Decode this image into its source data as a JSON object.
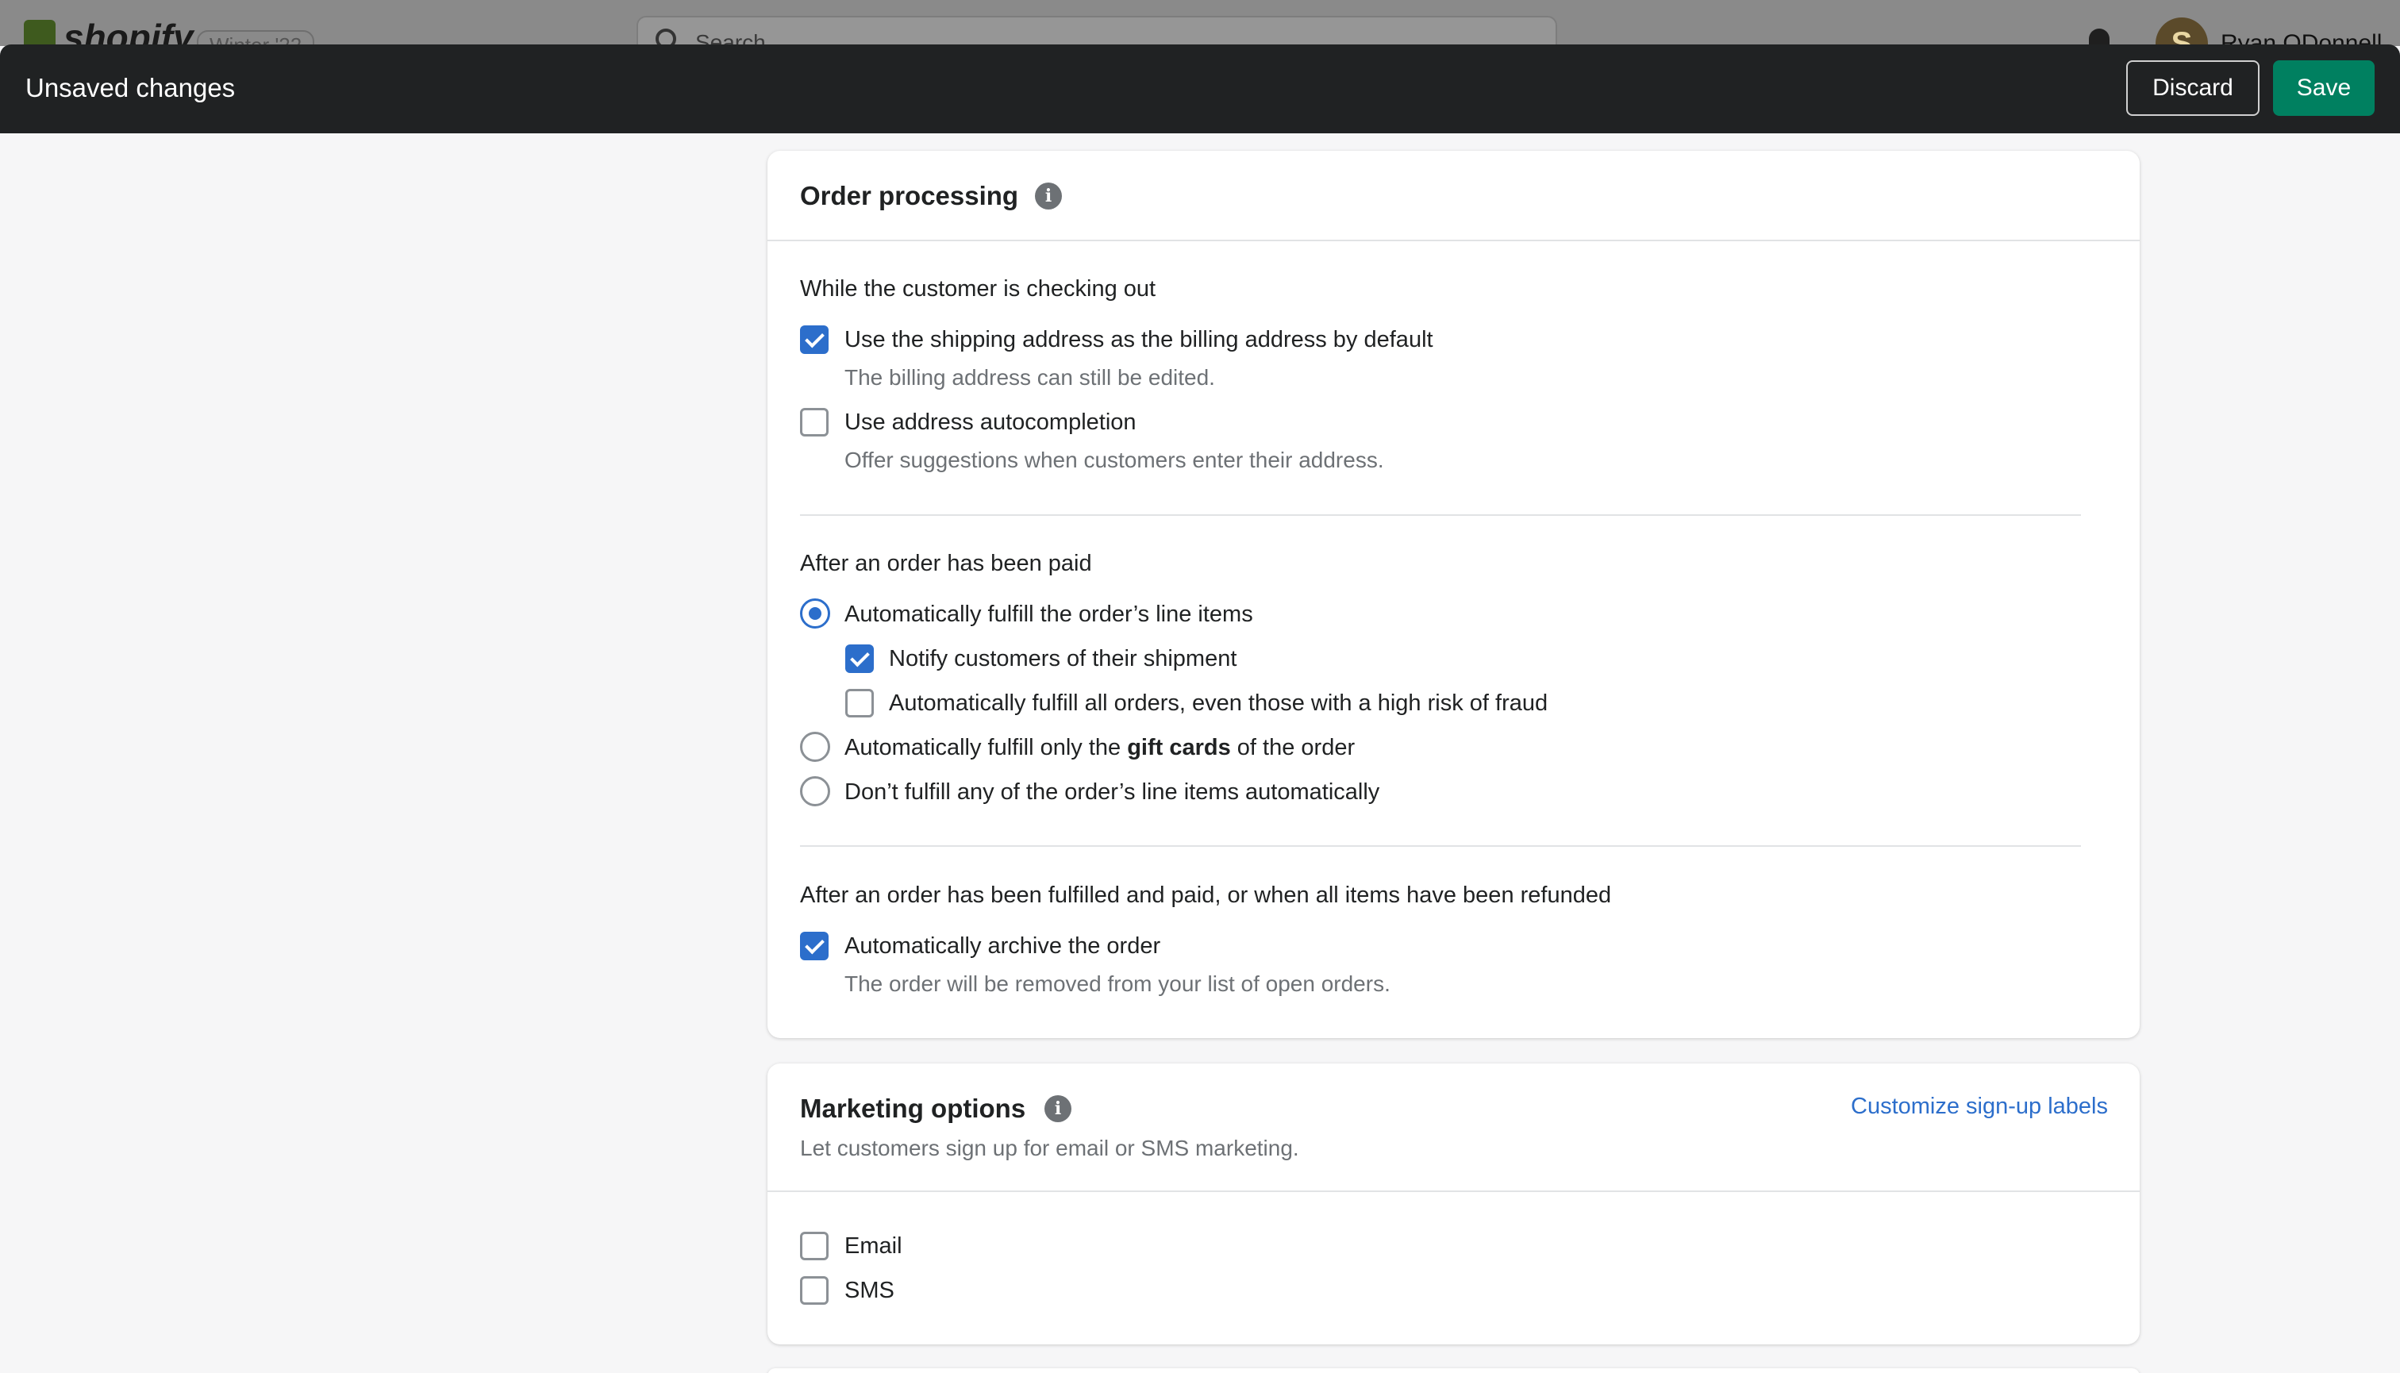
{
  "topbar": {
    "brand": "shopify",
    "edition_badge": "Winter '22",
    "search_placeholder": "Search",
    "user_initial": "S",
    "user_name": "Ryan ODonnell"
  },
  "savebar": {
    "title": "Unsaved changes",
    "discard_label": "Discard",
    "save_label": "Save",
    "save_color": "#008060"
  },
  "order_processing": {
    "title": "Order processing",
    "checkout_section": {
      "label": "While the customer is checking out",
      "options": [
        {
          "label": "Use the shipping address as the billing address by default",
          "help": "The billing address can still be edited.",
          "checked": true
        },
        {
          "label": "Use address autocompletion",
          "help": "Offer suggestions when customers enter their address.",
          "checked": false
        }
      ]
    },
    "paid_section": {
      "label": "After an order has been paid",
      "radio_auto_fulfill": {
        "label": "Automatically fulfill the order’s line items",
        "selected": true
      },
      "sub_notify": {
        "label": "Notify customers of their shipment",
        "checked": true
      },
      "sub_fraud": {
        "label": "Automatically fulfill all orders, even those with a high risk of fraud",
        "checked": false
      },
      "radio_gift_cards": {
        "prefix": "Automatically fulfill only the ",
        "bold": "gift cards",
        "suffix": " of the order",
        "selected": false
      },
      "radio_none": {
        "label": "Don’t fulfill any of the order’s line items automatically",
        "selected": false
      }
    },
    "archive_section": {
      "label": "After an order has been fulfilled and paid, or when all items have been refunded",
      "option": {
        "label": "Automatically archive the order",
        "help": "The order will be removed from your list of open orders.",
        "checked": true
      }
    }
  },
  "marketing_options": {
    "title": "Marketing options",
    "subtitle": "Let customers sign up for email or SMS marketing.",
    "customize_link": "Customize sign-up labels",
    "options": [
      {
        "label": "Email",
        "checked": false
      },
      {
        "label": "SMS",
        "checked": false
      }
    ]
  }
}
